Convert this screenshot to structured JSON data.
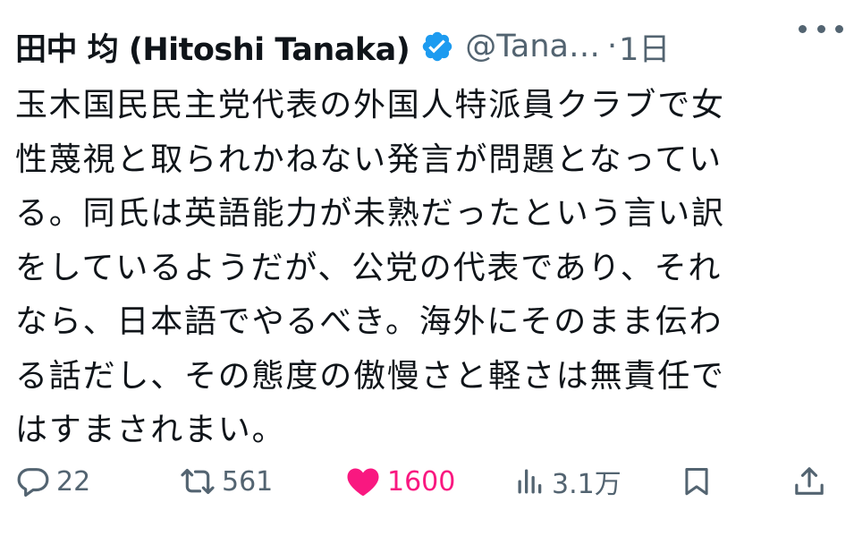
{
  "author": {
    "display_name": "田中 均 (Hitoshi Tanaka)",
    "handle": "@Tana…",
    "separator": "·",
    "time": "1日"
  },
  "icons": {
    "verified": "verified-badge-icon",
    "more": "more-dots-icon",
    "reply": "reply-bubble-icon",
    "retweet": "retweet-arrows-icon",
    "like": "heart-icon",
    "views": "views-bar-chart-icon",
    "bookmark": "bookmark-icon",
    "share": "share-upload-icon"
  },
  "colors": {
    "verified": "#1d9bf0",
    "like": "#f91880",
    "secondary": "#536471",
    "text": "#0f1419"
  },
  "body_lines": [
    "玉木国民民主党代表の外国人特派員クラブで女",
    "性蔑視と取られかねない発言が問題となってい",
    "る。同氏は英語能力が未熟だったという言い訳",
    "をしているようだが、公党の代表であり、それ",
    "なら、日本語でやるべき。海外にそのまま伝わ",
    "る話だし、その態度の傲慢さと軽さは無責任で",
    "はすまされまい。"
  ],
  "actions": {
    "replies": "22",
    "retweets": "561",
    "likes": "1600",
    "views": "3.1万",
    "liked": true
  }
}
